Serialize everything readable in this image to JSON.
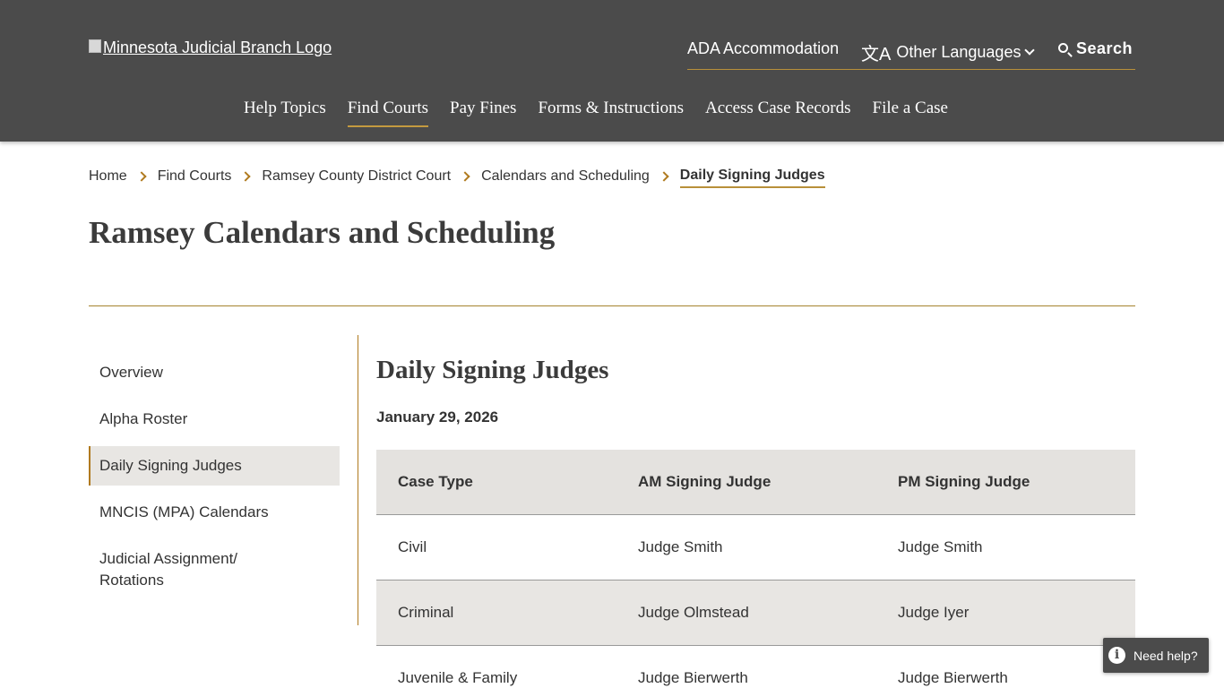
{
  "header": {
    "logo_alt": "Minnesota Judicial Branch Logo",
    "utility": {
      "ada": "ADA Accommodation",
      "languages": "Other Languages",
      "search": "Search"
    },
    "nav": [
      {
        "label": "Help Topics",
        "active": false
      },
      {
        "label": "Find Courts",
        "active": true
      },
      {
        "label": "Pay Fines",
        "active": false
      },
      {
        "label": "Forms & Instructions",
        "active": false
      },
      {
        "label": "Access Case Records",
        "active": false
      },
      {
        "label": "File a Case",
        "active": false
      }
    ]
  },
  "breadcrumb": [
    "Home",
    "Find Courts",
    "Ramsey County District Court",
    "Calendars and Scheduling",
    "Daily Signing Judges"
  ],
  "page_title": "Ramsey Calendars and Scheduling",
  "sidenav": {
    "items": [
      {
        "label": "Overview"
      },
      {
        "label": "Alpha Roster"
      },
      {
        "label": "Daily Signing Judges"
      },
      {
        "label": "MNCIS (MPA) Calendars"
      },
      {
        "label": "Judicial Assignment/",
        "label2": "Rotations"
      }
    ]
  },
  "content": {
    "title": "Daily Signing Judges",
    "date": "January 29, 2026",
    "table": {
      "headers": [
        "Case Type",
        "AM Signing Judge",
        "PM Signing Judge"
      ],
      "rows": [
        [
          "Civil",
          "Judge Smith",
          "Judge Smith"
        ],
        [
          "Criminal",
          "Judge Olmstead",
          "Judge Iyer"
        ],
        [
          "Juvenile & Family",
          "Judge Bierwerth",
          "Judge Bierwerth"
        ]
      ]
    }
  },
  "help": {
    "label": "Need help?",
    "icon": "info-icon"
  },
  "colors": {
    "header_bg": "#4b4b4b",
    "accent": "#b8903a",
    "shade": "#e8e6e3"
  }
}
